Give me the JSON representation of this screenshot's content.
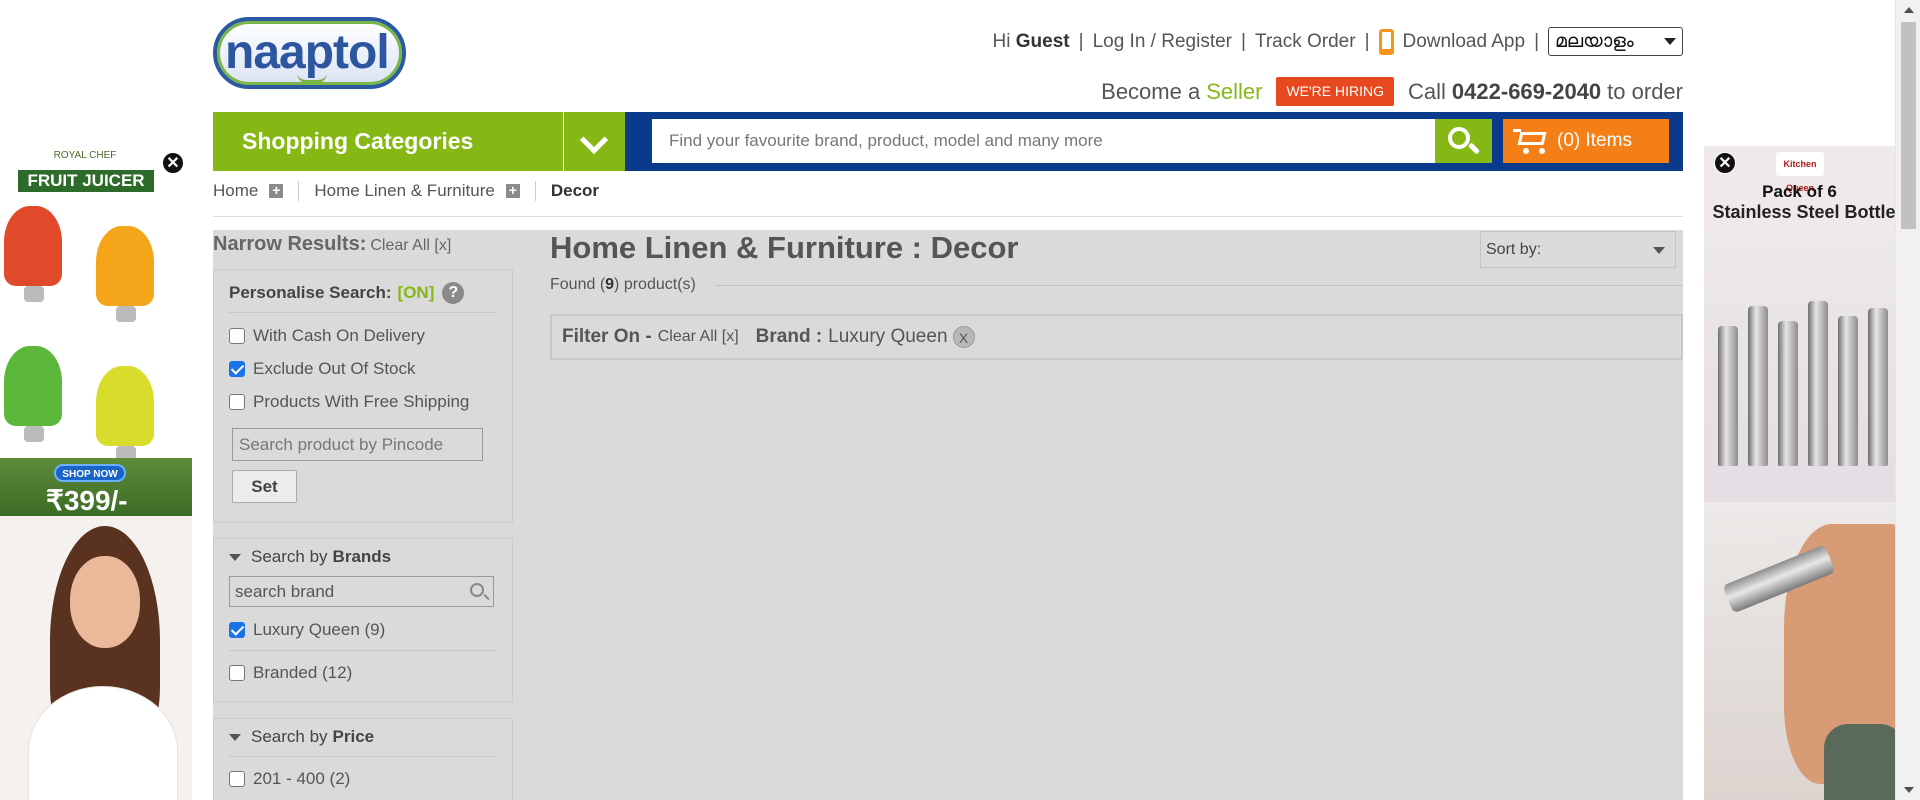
{
  "header": {
    "logo_text": "naaptol",
    "greeting_prefix": "Hi",
    "greeting_user": "Guest",
    "login_link": "Log In / Register",
    "track_order_link": "Track Order",
    "download_app_link": "Download App",
    "language_selected": "മലയാളം",
    "become_prefix": "Become a",
    "seller_link": "Seller",
    "hiring_badge": "WE'RE HIRING",
    "call_prefix": "Call",
    "phone_number": "0422-669-2040",
    "call_suffix": "to order"
  },
  "navbar": {
    "categories_label": "Shopping Categories",
    "search_placeholder": "Find your favourite brand, product, model and many more",
    "cart_label": "(0) Items"
  },
  "breadcrumb": {
    "items": [
      {
        "label": "Home"
      },
      {
        "label": "Home Linen & Furniture"
      },
      {
        "label": "Decor"
      }
    ]
  },
  "sidebar": {
    "narrow_title": "Narrow Results:",
    "clear_all": "Clear All [x]",
    "personalise": {
      "title": "Personalise Search:",
      "status": "[ON]",
      "help_icon": "?",
      "options": [
        {
          "label": "With Cash On Delivery",
          "checked": false
        },
        {
          "label": "Exclude Out Of Stock",
          "checked": true
        },
        {
          "label": "Products With Free Shipping",
          "checked": false
        }
      ],
      "pincode_placeholder": "Search product by Pincode",
      "set_button": "Set"
    },
    "brands": {
      "title_prefix": "Search by",
      "title_bold": "Brands",
      "search_placeholder": "search brand",
      "items": [
        {
          "label": "Luxury Queen (9)",
          "checked": true
        },
        {
          "label": "Branded (12)",
          "checked": false
        }
      ]
    },
    "price": {
      "title_prefix": "Search by",
      "title_bold": "Price",
      "items": [
        {
          "label": "201 - 400 (2)",
          "checked": false
        }
      ]
    }
  },
  "main": {
    "title": "Home Linen & Furniture : Decor",
    "found_prefix": "Found (",
    "found_count": "9",
    "found_suffix": ") product(s)",
    "sort_label": "Sort by:",
    "filter": {
      "label": "Filter On -",
      "clear_all": "Clear All [x]",
      "brand_label": "Brand :",
      "brand_value": "Luxury Queen",
      "remove_icon": "X"
    }
  },
  "ads": {
    "left": {
      "brand": "ROYAL CHEF",
      "title": "FRUIT JUICER",
      "cta": "SHOP NOW",
      "price": "₹399/-",
      "close": "✕"
    },
    "right": {
      "brand": "Kitchen Queen",
      "line1": "Pack of 6",
      "line2": "Stainless Steel Bottle",
      "close": "✕"
    }
  },
  "colors": {
    "brand_green": "#85b814",
    "nav_blue": "#0a3a8c",
    "cart_orange": "#f57f17",
    "hiring_red": "#e8481e",
    "overlay_gray": "#dadada"
  }
}
